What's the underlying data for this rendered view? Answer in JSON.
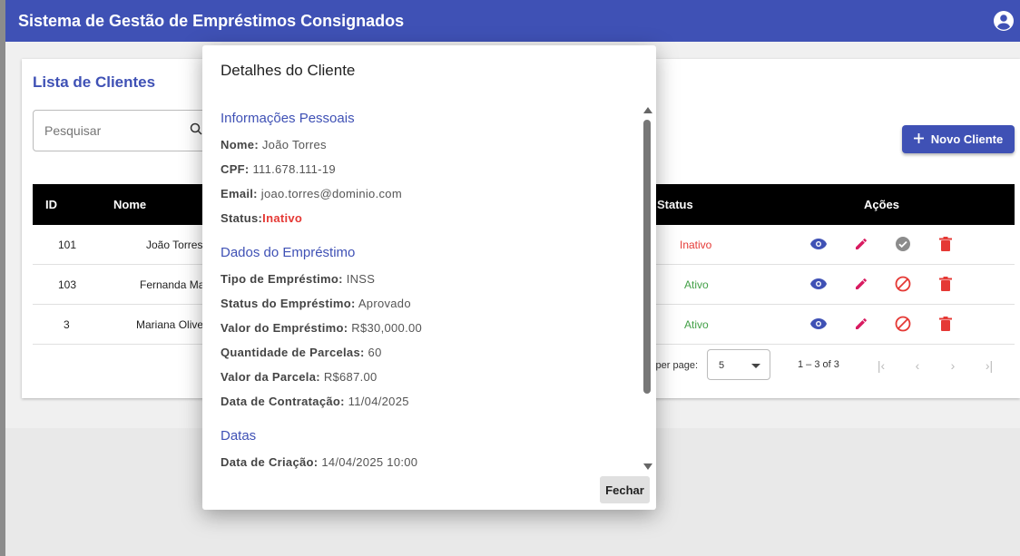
{
  "appbar": {
    "title": "Sistema de Gestão de Empréstimos Consignados"
  },
  "list": {
    "title": "Lista de Clientes",
    "search_placeholder": "Pesquisar",
    "new_button": "Novo Cliente",
    "columns": {
      "id": "ID",
      "name": "Nome",
      "status": "Status",
      "actions": "Ações"
    },
    "rows": [
      {
        "id": "101",
        "name": "João Torres",
        "status": "Inativo",
        "status_kind": "inactive"
      },
      {
        "id": "103",
        "name": "Fernanda Ma",
        "status": "Ativo",
        "status_kind": "active"
      },
      {
        "id": "3",
        "name": "Mariana Olive",
        "status": "Ativo",
        "status_kind": "active"
      }
    ],
    "pager": {
      "rows_per_page_label": "s per page:",
      "rows_per_page_value": "5",
      "range": "1 – 3 of 3"
    }
  },
  "dialog": {
    "title": "Detalhes do Cliente",
    "sections": {
      "personal": {
        "title": "Informações Pessoais",
        "name_label": "Nome:",
        "name_value": "João Torres",
        "cpf_label": "CPF:",
        "cpf_value": "111.678.111-19",
        "email_label": "Email:",
        "email_value": "joao.torres@dominio.com",
        "status_label": "Status:",
        "status_value": "Inativo"
      },
      "loan": {
        "title": "Dados do Empréstimo",
        "type_label": "Tipo de Empréstimo:",
        "type_value": "INSS",
        "loan_status_label": "Status do Empréstimo:",
        "loan_status_value": "Aprovado",
        "amount_label": "Valor do Empréstimo:",
        "amount_value": "R$30,000.00",
        "installments_label": "Quantidade de Parcelas:",
        "installments_value": "60",
        "installment_value_label": "Valor da Parcela:",
        "installment_value_value": "R$687.00",
        "contract_date_label": "Data de Contratação:",
        "contract_date_value": "11/04/2025"
      },
      "dates": {
        "title": "Datas",
        "created_label": "Data de Criação:",
        "created_value": "14/04/2025 10:00"
      }
    },
    "close_button": "Fechar"
  },
  "colors": {
    "primary": "#3f51b5",
    "danger": "#e53935",
    "success": "#43a047",
    "pink": "#d81b60"
  },
  "icons": [
    "account-circle-icon",
    "search-icon",
    "plus-icon",
    "view-icon",
    "edit-icon",
    "activate-icon",
    "deactivate-icon",
    "delete-icon",
    "first-page-icon",
    "prev-page-icon",
    "next-page-icon",
    "last-page-icon"
  ]
}
